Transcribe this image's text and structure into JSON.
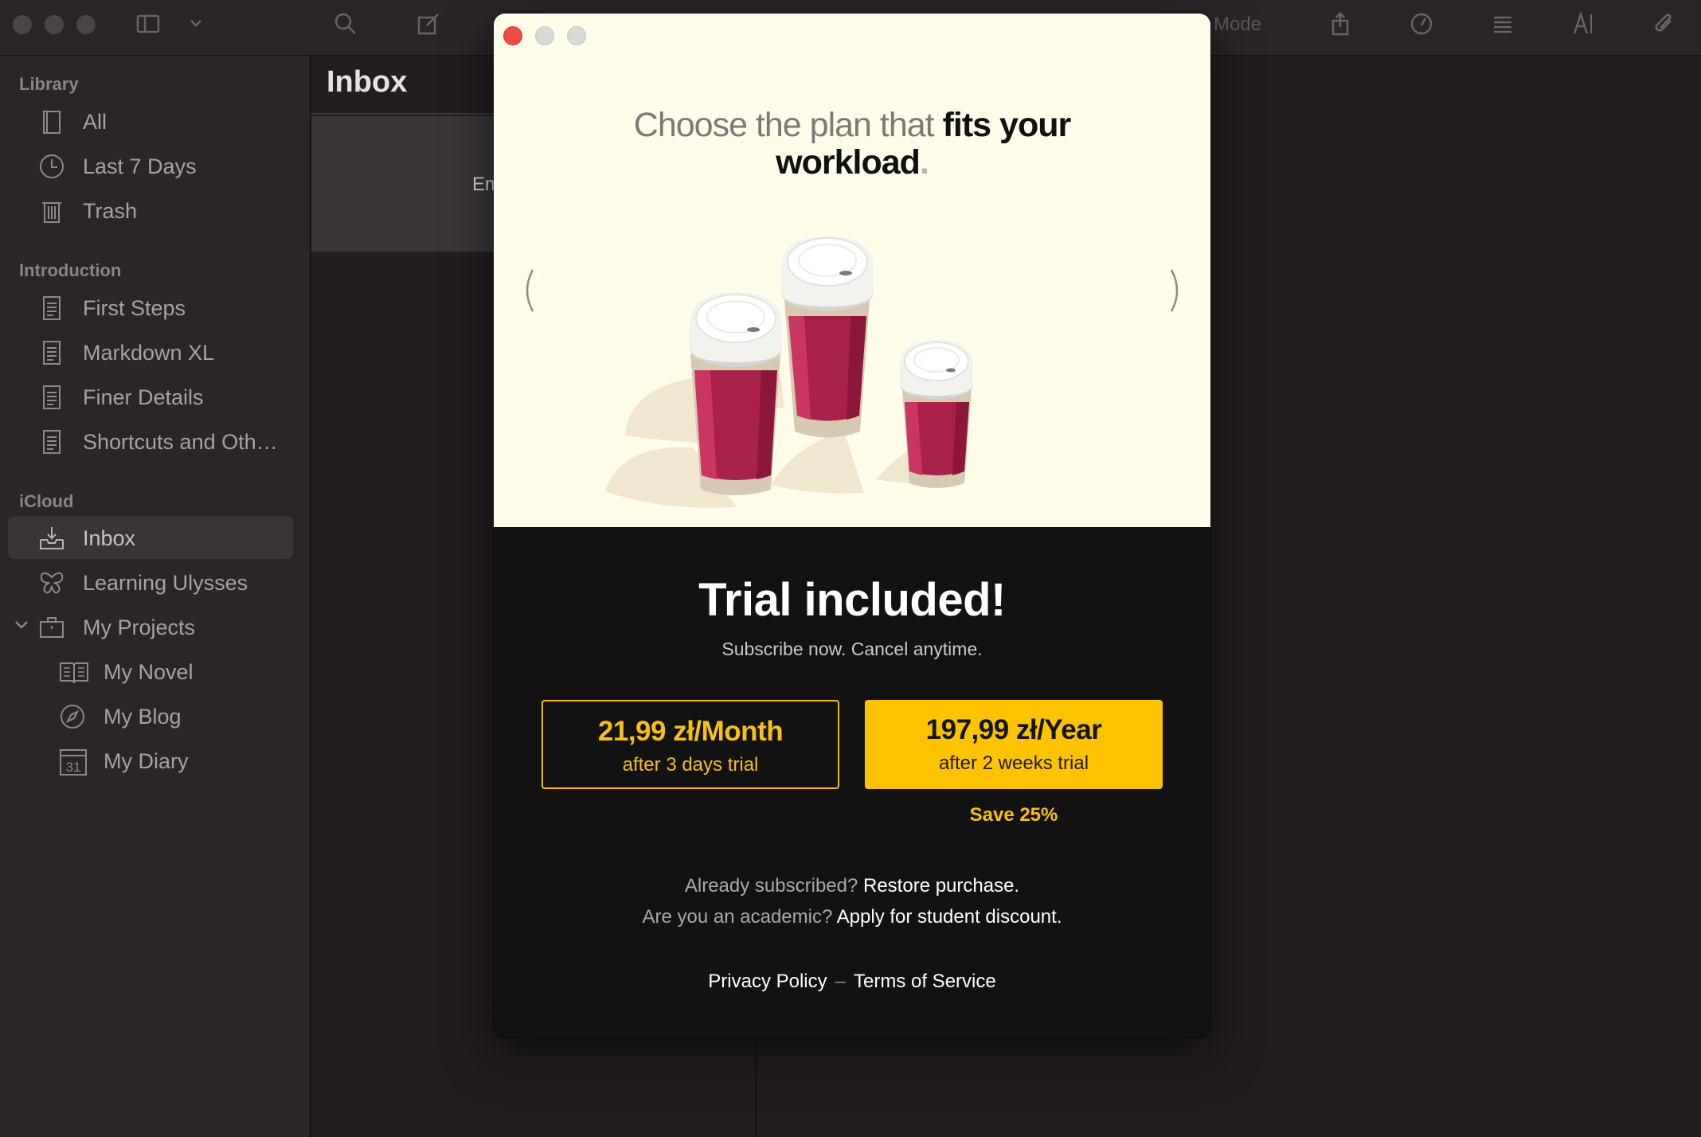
{
  "toolbar": {
    "mode_label": "ly Mode"
  },
  "sidebar": {
    "sections": [
      {
        "title": "Library",
        "items": [
          {
            "label": "All",
            "icon": "book-icon"
          },
          {
            "label": "Last 7 Days",
            "icon": "clock-icon"
          },
          {
            "label": "Trash",
            "icon": "trash-icon"
          }
        ]
      },
      {
        "title": "Introduction",
        "items": [
          {
            "label": "First Steps",
            "icon": "document-icon"
          },
          {
            "label": "Markdown XL",
            "icon": "document-icon"
          },
          {
            "label": "Finer Details",
            "icon": "document-icon"
          },
          {
            "label": "Shortcuts and Oth…",
            "icon": "document-icon"
          }
        ]
      },
      {
        "title": "iCloud",
        "items": [
          {
            "label": "Inbox",
            "icon": "inbox-icon",
            "selected": true
          },
          {
            "label": "Learning Ulysses",
            "icon": "butterfly-icon"
          },
          {
            "label": "My Projects",
            "icon": "briefcase-icon",
            "expanded": true
          },
          {
            "label": "My Novel",
            "icon": "open-book-icon"
          },
          {
            "label": "My Blog",
            "icon": "compass-icon"
          },
          {
            "label": "My Diary",
            "icon": "calendar-icon",
            "icon_text": "31"
          }
        ]
      }
    ]
  },
  "sheet_list": {
    "title": "Inbox",
    "card_text": "Em"
  },
  "paywall": {
    "headline_muted": "Choose the plan that ",
    "headline_strong_1": "fits your",
    "headline_strong_2": "workload",
    "headline_dot": ".",
    "title": "Trial included!",
    "subtitle": "Subscribe now. Cancel anytime.",
    "plans": [
      {
        "price": "21,99 zł/Month",
        "trial": "after 3 days trial"
      },
      {
        "price": "197,99 zł/Year",
        "trial": "after 2 weeks trial"
      }
    ],
    "save_label": "Save 25%",
    "restore_question": "Already subscribed?",
    "restore_link": "Restore purchase.",
    "academic_question": "Are you an academic?",
    "academic_link": "Apply for student discount.",
    "privacy_link": "Privacy Policy",
    "legal_separator": "–",
    "terms_link": "Terms of Service",
    "colors": {
      "accent": "#fdc301",
      "hero_bg": "#fffdea",
      "cup_red": "#a82148"
    }
  }
}
